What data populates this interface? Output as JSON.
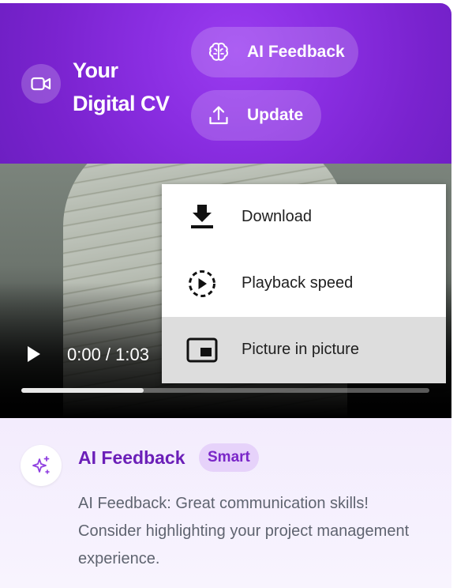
{
  "header": {
    "title_line1": "Your",
    "title_line2": "Digital CV",
    "ai_feedback_button": "AI Feedback",
    "update_button": "Update"
  },
  "video": {
    "time": "0:00 / 1:03",
    "progress_fraction": 0.3
  },
  "menu": {
    "items": [
      {
        "label": "Download",
        "icon": "download-icon"
      },
      {
        "label": "Playback speed",
        "icon": "playback-speed-icon"
      },
      {
        "label": "Picture in picture",
        "icon": "picture-in-picture-icon"
      }
    ]
  },
  "feedback": {
    "title": "AI Feedback",
    "badge": "Smart",
    "text": "AI Feedback: Great communication skills! Consider highlighting your project management experience."
  },
  "colors": {
    "header_purple": "#8a2ee2",
    "feedback_title": "#6b1fb8",
    "badge_bg": "#e6d2fa"
  }
}
